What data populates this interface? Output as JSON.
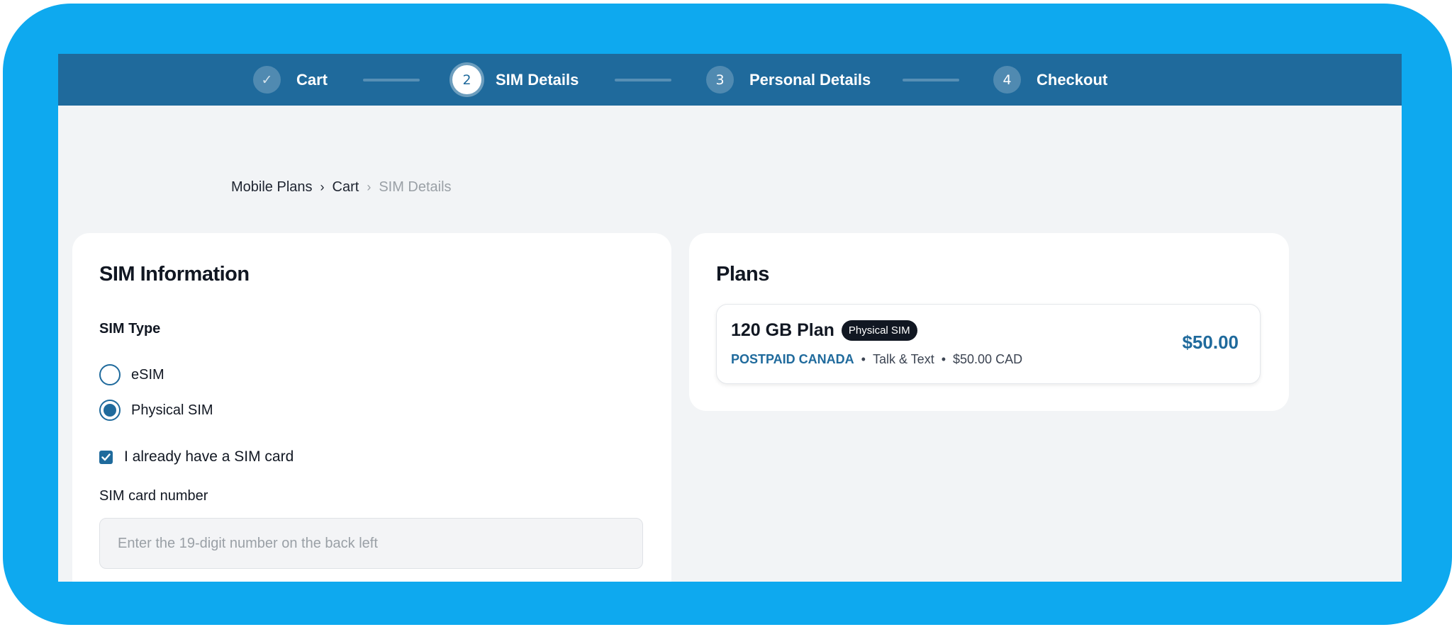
{
  "stepper": {
    "steps": [
      {
        "marker": "✓",
        "label": "Cart",
        "state": "done"
      },
      {
        "marker": "2",
        "label": "SIM Details",
        "state": "active"
      },
      {
        "marker": "3",
        "label": "Personal Details",
        "state": "upcoming"
      },
      {
        "marker": "4",
        "label": "Checkout",
        "state": "upcoming"
      }
    ]
  },
  "breadcrumb": {
    "items": [
      "Mobile Plans",
      "Cart",
      "SIM Details"
    ],
    "separator": "›"
  },
  "sim_info": {
    "title": "SIM Information",
    "sim_type_label": "SIM Type",
    "options": [
      {
        "label": "eSIM",
        "selected": false
      },
      {
        "label": "Physical SIM",
        "selected": true
      }
    ],
    "have_sim_label": "I already have a SIM card",
    "have_sim_checked": true,
    "sim_number_label": "SIM card number",
    "sim_number_value": "",
    "sim_number_placeholder": "Enter the 19-digit number on the back left"
  },
  "plans": {
    "title": "Plans",
    "items": [
      {
        "name": "120 GB Plan",
        "badge": "Physical SIM",
        "carrier": "POSTPAID CANADA",
        "features": "Talk & Text",
        "price_detail": "$50.00 CAD",
        "price": "$50.00"
      }
    ]
  },
  "colors": {
    "frame": "#0ea9ef",
    "header": "#1f6a9c",
    "accent": "#1f6a9c",
    "background": "#f2f4f6"
  }
}
